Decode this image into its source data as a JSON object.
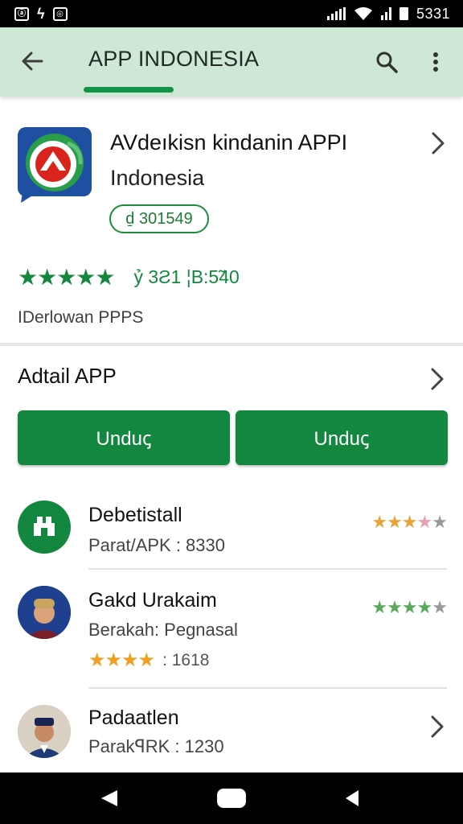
{
  "status_bar": {
    "time": "5331",
    "left_icons": [
      "notification-icon",
      "lightning-icon",
      "instagram-icon"
    ]
  },
  "app_bar": {
    "title": "APP INDONESIA",
    "back_icon": "arrow-left-icon",
    "search_icon": "search-icon",
    "more_icon": "more-vert-icon"
  },
  "app": {
    "name_line1": "AVdeıkisn kindanin APPI",
    "name_line2": "Indonesia",
    "size_badge": "ḏ 301549",
    "rating_stars": 5,
    "rating_count": "ỷ 3Ƨ1 ¦B:5̃40",
    "developer": "IDerlowan PPPS",
    "colors": {
      "accent": "#13873f",
      "app_bar": "#cfe8d6"
    }
  },
  "detail": {
    "label": "Adtail APP"
  },
  "buttons": [
    {
      "label": "Unduꞔ"
    },
    {
      "label": "Unduꞔ"
    }
  ],
  "list": [
    {
      "title": "Debetistall",
      "subtitle": "Parat/APK : 8330",
      "rating": 3.5,
      "rating_color": "#e8a33a",
      "avatar_icon": "home-icon"
    },
    {
      "title": "Gakd Urakaim",
      "subtitle": "Berakah: Pegnasal",
      "rating": 4,
      "rating_color": "#5aa95a",
      "small_rating_count": ": 1618",
      "avatar_icon": "person-avatar"
    },
    {
      "title": "Padaatlen",
      "subtitle": "ParakꟼRK : 1230",
      "avatar_icon": "person-avatar"
    }
  ],
  "nav_bar": {
    "back_icon": "nav-back-icon",
    "home_icon": "nav-home-icon",
    "recent_icon": "nav-recent-icon"
  }
}
